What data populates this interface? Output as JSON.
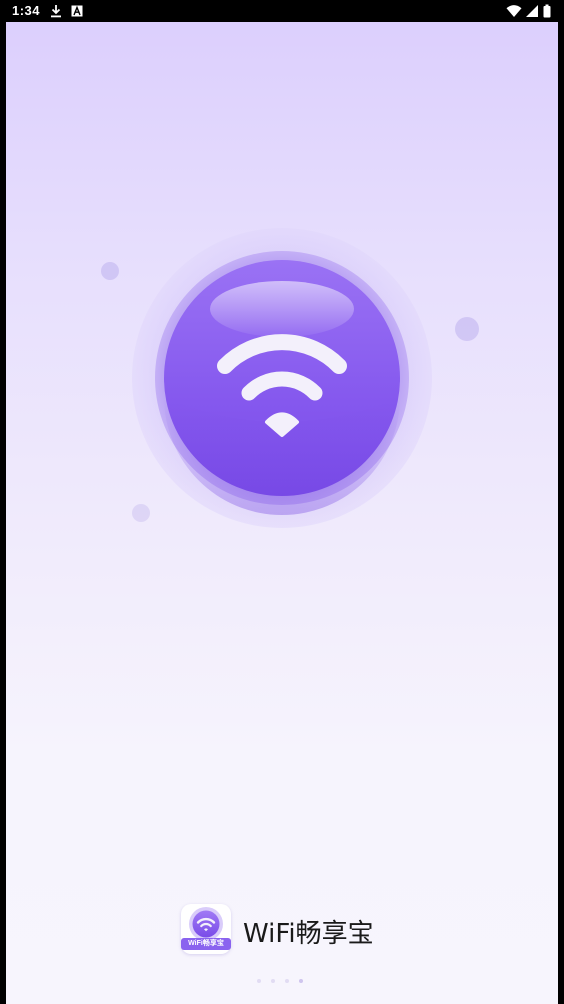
{
  "status_bar": {
    "time": "1:34",
    "left_icons": [
      "download-icon",
      "a-box-icon"
    ],
    "right_icons": [
      "wifi-icon",
      "signal-icon",
      "battery-icon"
    ]
  },
  "splash": {
    "app_name": "WiFi畅享宝",
    "icon_label": "WiFi畅享宝",
    "page_indicator": {
      "count": 4,
      "active_index": 3
    }
  },
  "colors": {
    "accent": "#8a63ef",
    "background_top": "#dccffd",
    "background_bottom": "#f7f5fd"
  }
}
